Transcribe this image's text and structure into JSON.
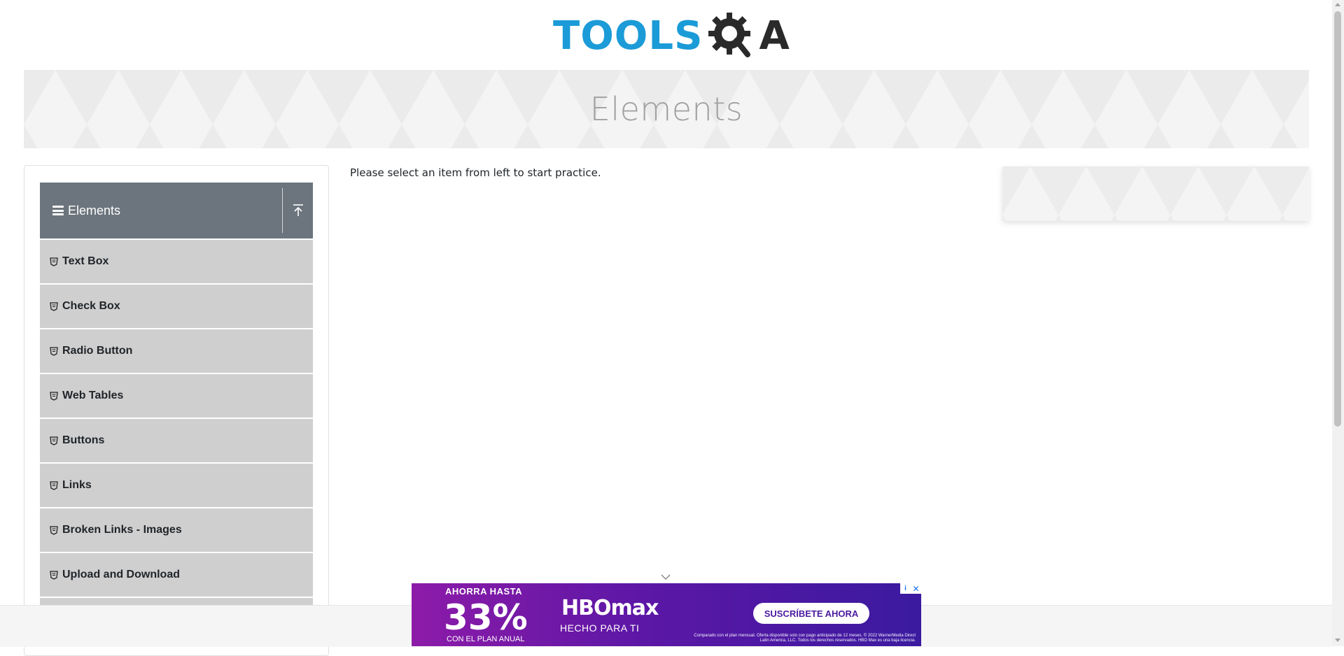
{
  "header": {
    "logo_text": "TOOLS",
    "logo_suffix": "A"
  },
  "banner": {
    "title": "Elements"
  },
  "sidebar": {
    "group_title": "Elements",
    "items": [
      {
        "label": "Text Box"
      },
      {
        "label": "Check Box"
      },
      {
        "label": "Radio Button"
      },
      {
        "label": "Web Tables"
      },
      {
        "label": "Buttons"
      },
      {
        "label": "Links"
      },
      {
        "label": "Broken Links - Images"
      },
      {
        "label": "Upload and Download"
      }
    ]
  },
  "main": {
    "message": "Please select an item from left to start practice."
  },
  "ad": {
    "top_text": "AHORRA HASTA",
    "percent": "33%",
    "plan_text": "CON EL PLAN ANUAL",
    "brand": "HBOmax",
    "tagline": "HECHO PARA TI",
    "cta": "SUSCRÍBETE AHORA",
    "fine_print": "Comparado con el plan mensual. Oferta disponible solo con pago anticipado de 12 meses. © 2022 WarnerMedia Direct Latin America, LLC. Todos los derechos reservados. HBO Max es una baja licencia."
  },
  "colors": {
    "brand_blue": "#1b9bd7",
    "group_header_bg": "#6c757d",
    "item_bg": "#cfcfcf",
    "ad_purple": "#5c17a6"
  },
  "icons": [
    "menu-icon",
    "upload-icon",
    "shield-icon",
    "gear-search-icon",
    "chevron-down-icon",
    "info-icon",
    "close-icon"
  ]
}
